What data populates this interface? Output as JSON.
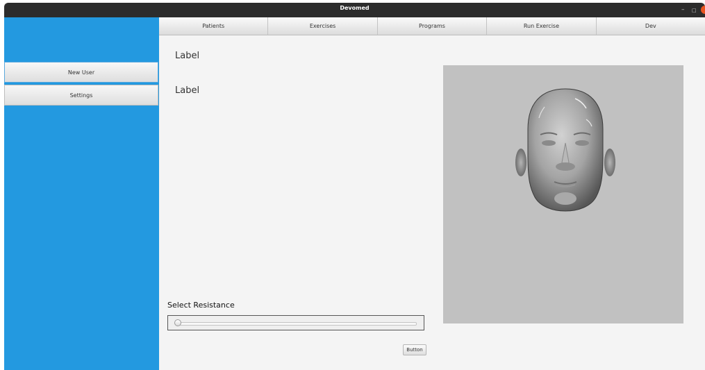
{
  "window": {
    "title": "Devomed",
    "controls": {
      "minimize": "–",
      "maximize": "□"
    }
  },
  "sidebar": {
    "items": [
      {
        "label": "New User"
      },
      {
        "label": "Settings"
      }
    ]
  },
  "tabs": [
    {
      "label": "Patients"
    },
    {
      "label": "Exercises"
    },
    {
      "label": "Programs"
    },
    {
      "label": "Run Exercise"
    },
    {
      "label": "Dev"
    }
  ],
  "main": {
    "label1": "Label",
    "label2": "Label",
    "resistance_label": "Select Resistance",
    "resistance_value": 0,
    "button_label": "Button"
  },
  "viewport": {
    "content": "3d-face-model"
  },
  "colors": {
    "sidebar": "#2399e0",
    "titlebar": "#2c2c2c",
    "viewport": "#c1c1c1",
    "close": "#e9541f"
  }
}
